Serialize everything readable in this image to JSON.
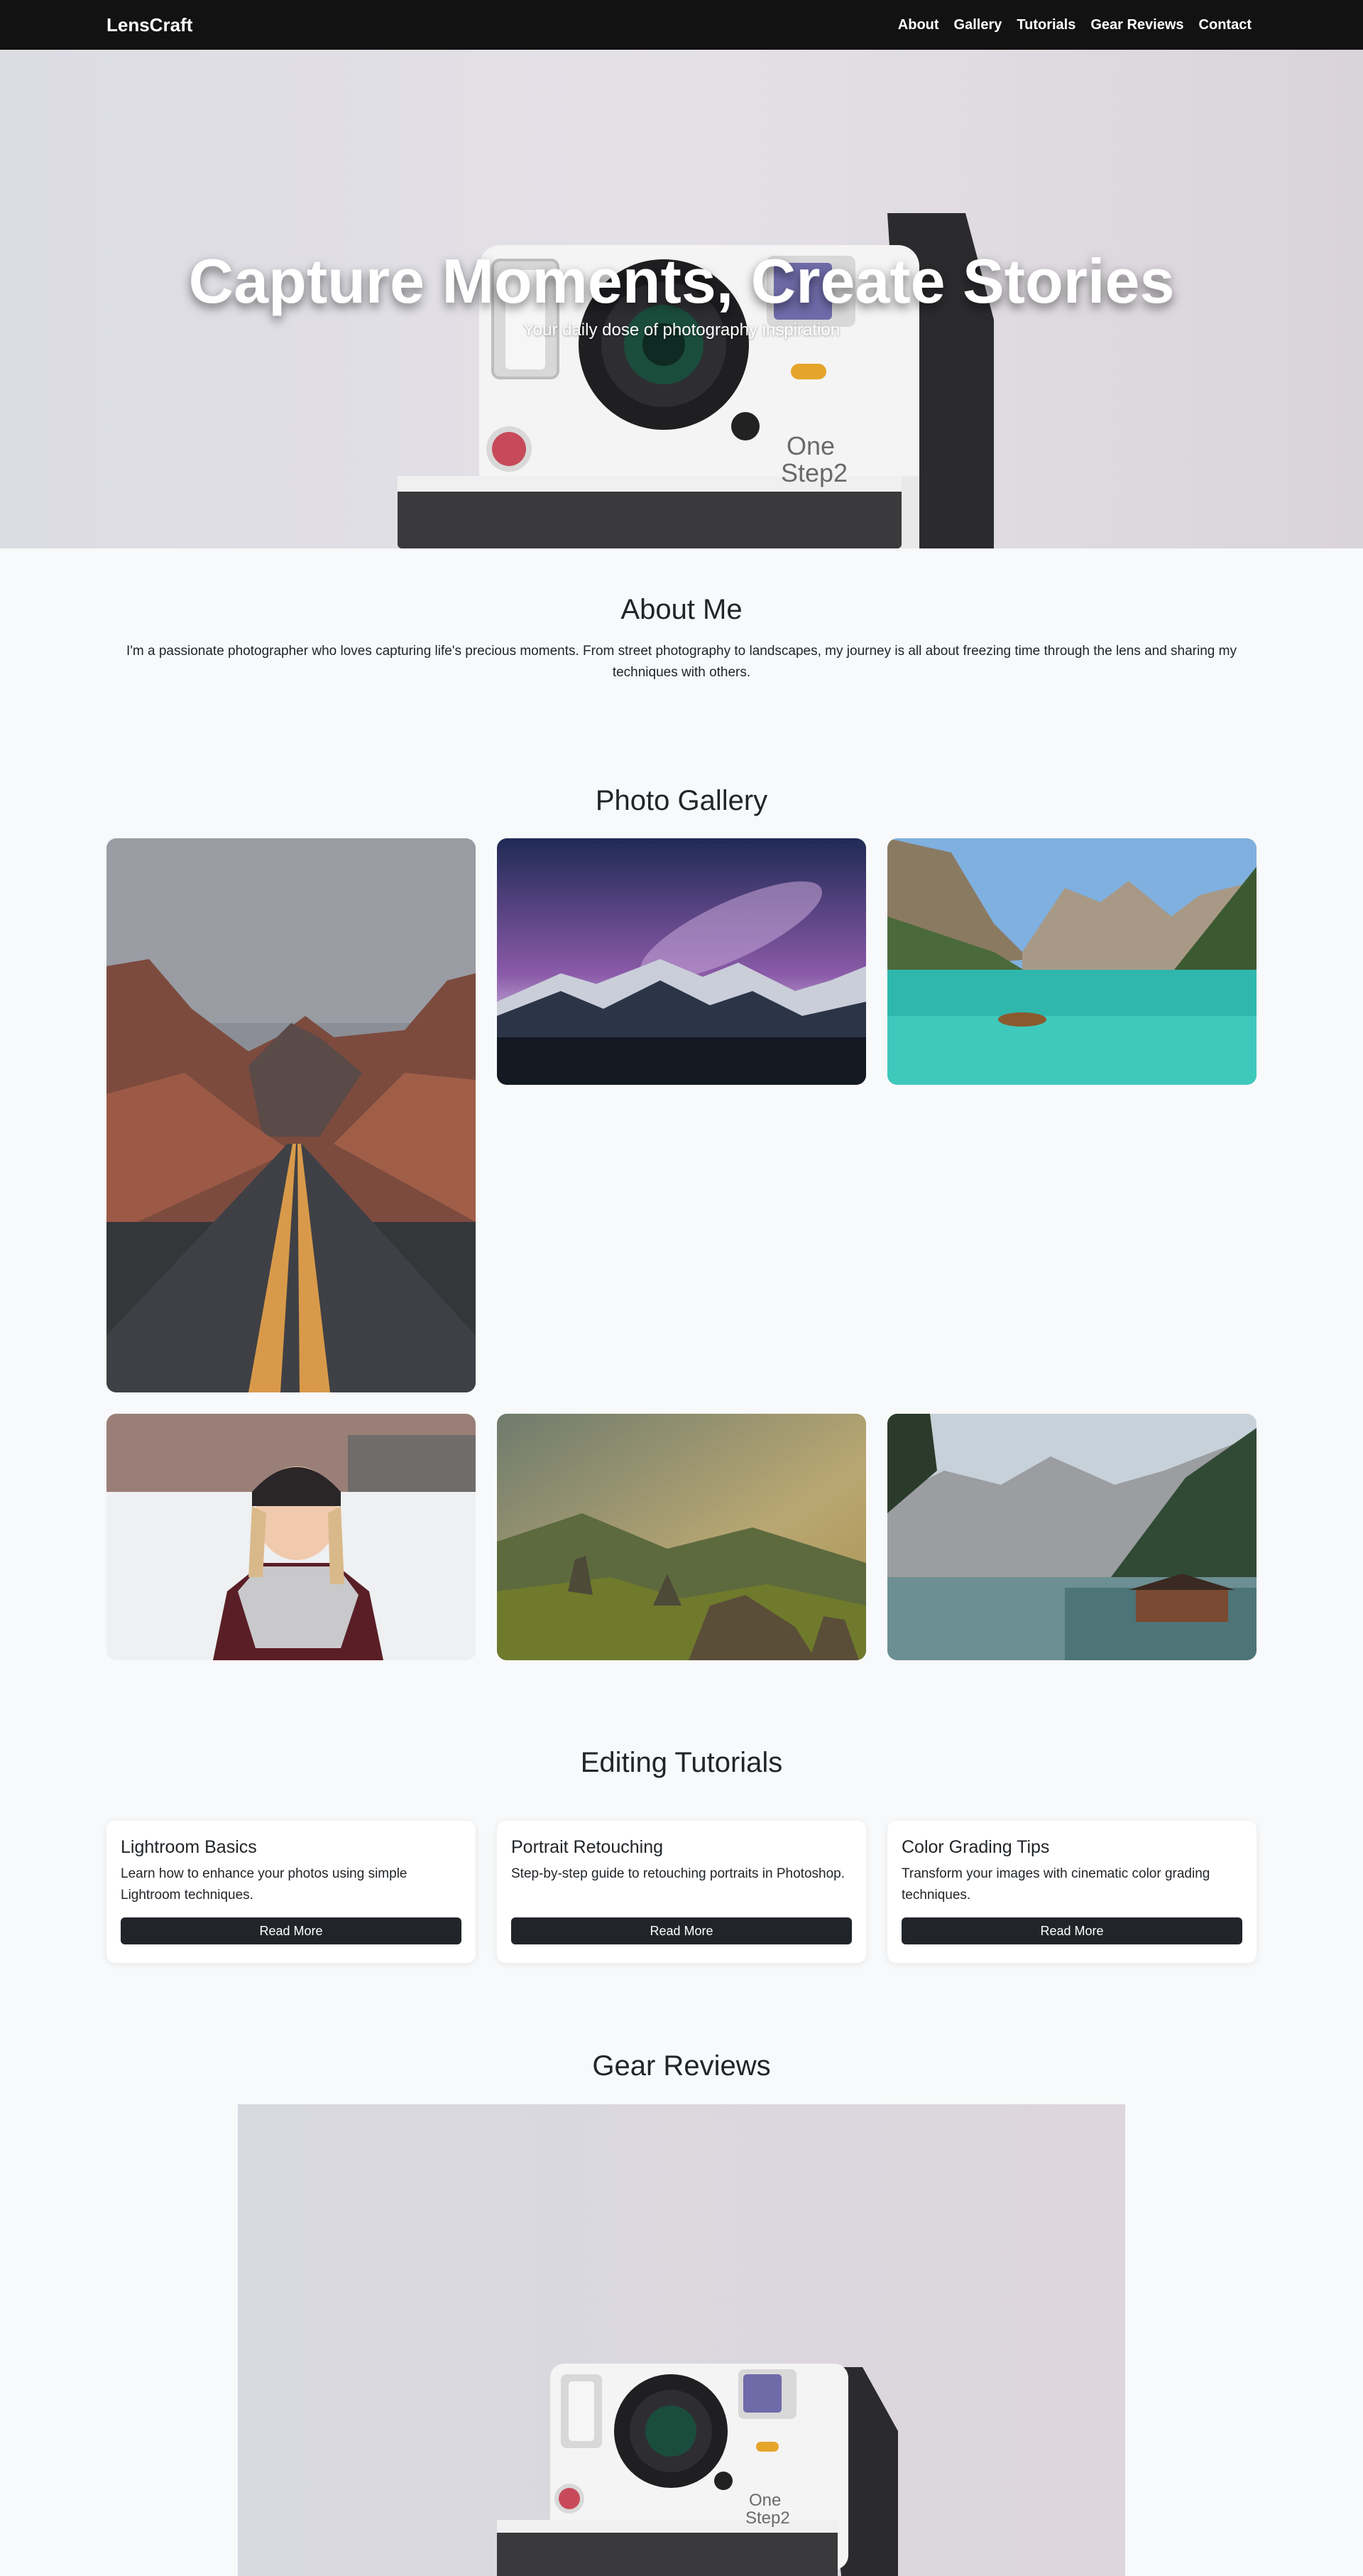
{
  "nav": {
    "brand": "LensCraft",
    "links": [
      "About",
      "Gallery",
      "Tutorials",
      "Gear Reviews",
      "Contact"
    ]
  },
  "hero": {
    "title": "Capture Moments, Create Stories",
    "subtitle": "Your daily dose of photography inspiration"
  },
  "about": {
    "title": "About Me",
    "text": "I'm a passionate photographer who loves capturing life's precious moments. From street photography to landscapes, my journey is all about freezing time through the lens and sharing my techniques with others."
  },
  "gallery": {
    "title": "Photo Gallery"
  },
  "camera_brand_text": [
    "One",
    "Step2"
  ],
  "tutorials": {
    "title": "Editing Tutorials",
    "cards": [
      {
        "title": "Lightroom Basics",
        "text": "Learn how to enhance your photos using simple Lightroom techniques.",
        "button": "Read More"
      },
      {
        "title": "Portrait Retouching",
        "text": "Step-by-step guide to retouching portraits in Photoshop.",
        "button": "Read More"
      },
      {
        "title": "Color Grading Tips",
        "text": "Transform your images with cinematic color grading techniques.",
        "button": "Read More"
      }
    ]
  },
  "gear": {
    "title": "Gear Reviews"
  }
}
